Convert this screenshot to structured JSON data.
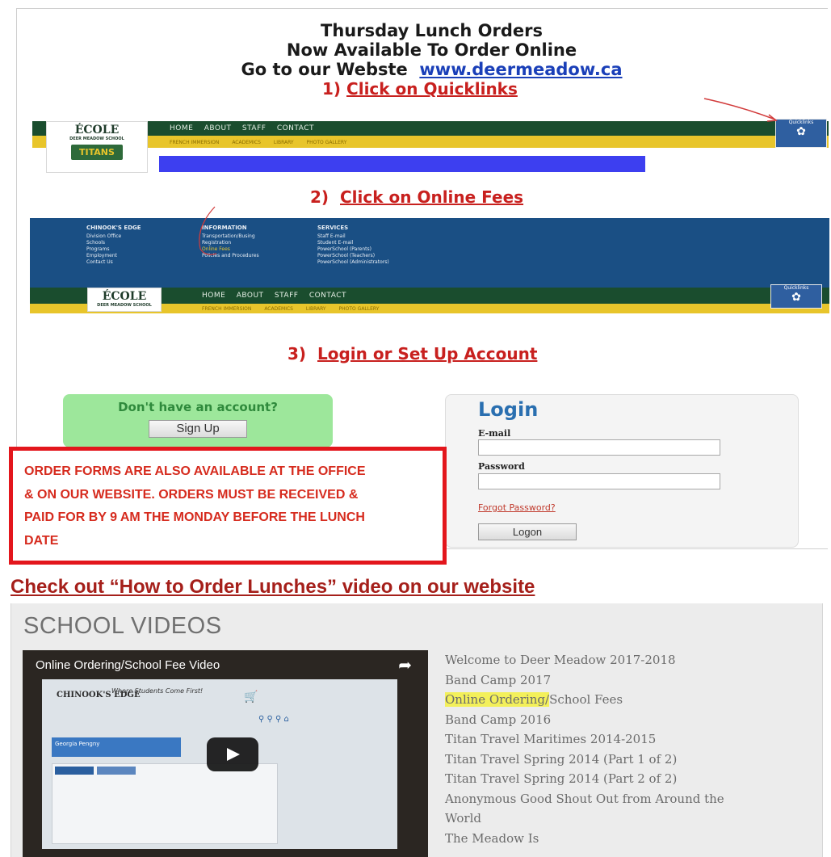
{
  "header": {
    "line1": "Thursday Lunch Orders",
    "line2": "Now Available To Order Online",
    "line3_prefix": "Go to our Webste",
    "website": "www.deermeadow.ca"
  },
  "steps": {
    "step1_num": "1)",
    "step1_text": "Click on Quicklinks",
    "step2_num": "2)",
    "step2_text": "Click on Online Fees",
    "step3_num": "3)",
    "step3_text": "Login or Set Up Account"
  },
  "site_banner": {
    "logo_title": "ÉCOLE",
    "logo_sub": "DEER MEADOW SCHOOL",
    "team": "TITANS",
    "nav": [
      "HOME",
      "ABOUT",
      "STAFF",
      "CONTACT"
    ],
    "subnav": [
      "FRENCH IMMERSION",
      "ACADEMICS",
      "LIBRARY",
      "PHOTO GALLERY"
    ],
    "quicklinks": "Quicklinks"
  },
  "info_menu": {
    "col1": {
      "heading": "CHINOOK'S EDGE",
      "items": [
        "Division Office",
        "Schools",
        "Programs",
        "Employment",
        "Contact Us"
      ]
    },
    "col2": {
      "heading": "INFORMATION",
      "items": [
        "Transportation/Busing",
        "Registration",
        "Online Fees",
        "Policies and Procedures"
      ]
    },
    "col3": {
      "heading": "SERVICES",
      "items": [
        "Staff E-mail",
        "Student E-mail",
        "PowerSchool (Parents)",
        "PowerSchool (Teachers)",
        "PowerSchool (Administrators)"
      ]
    }
  },
  "signup": {
    "question": "Don't have an account?",
    "button": "Sign Up"
  },
  "login": {
    "title": "Login",
    "email_label": "E-mail",
    "password_label": "Password",
    "forgot": "Forgot Password?",
    "button": "Logon"
  },
  "notice": {
    "line1": "ORDER FORMS ARE ALSO AVAILABLE AT THE OFFICE",
    "line2": "& ON OUR WEBSITE. ORDERS MUST BE RECEIVED &",
    "line3": "PAID FOR BY 9 AM THE MONDAY BEFORE THE LUNCH",
    "line4": "DATE"
  },
  "checkout": "Check out  “How to Order Lunches” video on our website",
  "videos": {
    "heading": "SCHOOL VIDEOS",
    "player_title": "Online Ordering/School Fee Video",
    "player_brand": "CHINOOK'S EDGE",
    "player_tagline": "Where Students Come First!",
    "player_user": "Georgia Pengny",
    "list": [
      "Welcome to Deer Meadow 2017-2018",
      "Band Camp 2017",
      "Band Camp 2016",
      "Titan Travel Maritimes 2014-2015",
      "Titan Travel Spring 2014 (Part 1 of 2)",
      "Titan Travel Spring 2014 (Part 2 of 2)",
      "Anonymous Good Shout Out from Around the",
      "World",
      "The Meadow Is"
    ],
    "highlight_part": "Online Ordering/",
    "highlight_rest": "School Fees",
    "highlight_color": "#f3f05a"
  },
  "colors": {
    "step_red": "#c8201e",
    "link_blue": "#1a3fb8",
    "banner_green": "#1a4d2e",
    "banner_yellow": "#e8c52b",
    "notice_red": "#e3161c"
  }
}
